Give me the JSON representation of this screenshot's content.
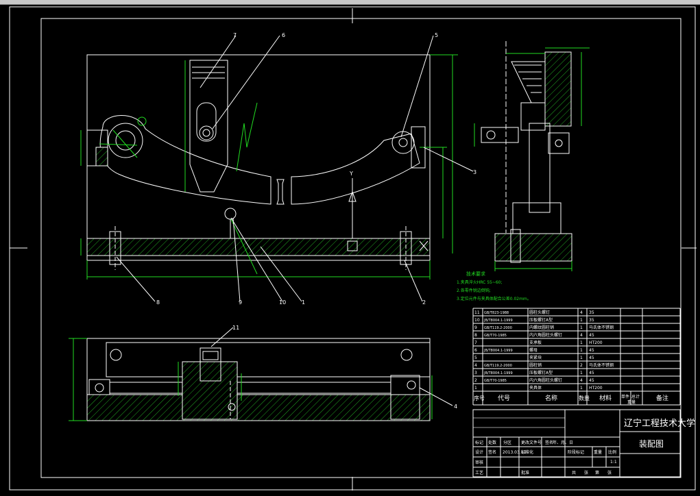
{
  "drawing": {
    "title_school": "辽宁工程技术大学",
    "title_name": "装配图",
    "scale": "1:1"
  },
  "colors": {
    "background": "#000000",
    "lines": "#ffffff",
    "dimensions": "#22dd22",
    "hatch": "#22aa22"
  },
  "balloons": [
    "7",
    "6",
    "5",
    "3",
    "8",
    "9",
    "10",
    "1",
    "2",
    "11",
    "4"
  ],
  "view_markers": [
    "Y"
  ],
  "notes": {
    "heading": "技术要求",
    "items": [
      "1.夹具淬火HRC 55~60;",
      "2.各零件锐边倒钝;",
      "3.定位元件与夹具体配合公差0.02mm。"
    ]
  },
  "bom": {
    "headers": [
      "序号",
      "代号",
      "名称",
      "数量",
      "材料",
      "单件",
      "总计",
      "备注"
    ],
    "weight_label": "重量",
    "rows": [
      [
        "11",
        "GB/T823-1988",
        "圆柱头螺钉",
        "4",
        "35",
        ""
      ],
      [
        "10",
        "JB/T8004.1-1999",
        "压板螺钉A型",
        "1",
        "35",
        ""
      ],
      [
        "9",
        "GB/T119.2-2000",
        "内螺纹圆柱销",
        "1",
        "马氏体不锈钢",
        ""
      ],
      [
        "8",
        "GB/T70-1985",
        "内六角圆柱头螺钉",
        "4",
        "45",
        ""
      ],
      [
        "7",
        "",
        "支承板",
        "1",
        "HT200",
        ""
      ],
      [
        "6",
        "JB/T8004.1-1999",
        "螺母",
        "1",
        "45",
        ""
      ],
      [
        "5",
        "",
        "夹紧块",
        "1",
        "45",
        ""
      ],
      [
        "4",
        "GB/T119.2-2000",
        "圆柱销",
        "2",
        "马氏体不锈钢",
        ""
      ],
      [
        "3",
        "JB/T8004.1-1999",
        "压板螺钉A型",
        "1",
        "45",
        ""
      ],
      [
        "2",
        "GB/T70-1985",
        "内六角圆柱头螺钉",
        "4",
        "45",
        ""
      ],
      [
        "1",
        "",
        "夹具体",
        "1",
        "HT200",
        ""
      ]
    ]
  },
  "title_block": {
    "row1": [
      "标记",
      "处数",
      "分区",
      "更改文件号",
      "签名",
      "年、月、日"
    ],
    "row2": [
      "设计",
      "签名",
      "2013.03.13",
      "标准化"
    ],
    "stage_labels": [
      "阶段标记",
      "重量",
      "比例"
    ],
    "review": "审核",
    "process": "工艺",
    "approve": "批准",
    "sheet": [
      "共",
      "张",
      "第",
      "张"
    ]
  }
}
